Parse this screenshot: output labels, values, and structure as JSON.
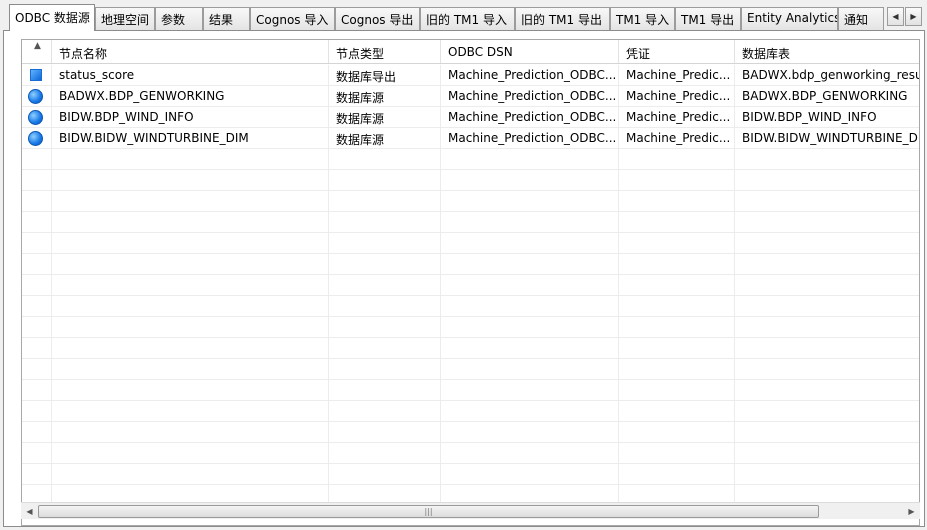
{
  "tabs": [
    {
      "label": "ODBC 数据源"
    },
    {
      "label": "地理空间"
    },
    {
      "label": "参数"
    },
    {
      "label": "结果"
    },
    {
      "label": "Cognos 导入"
    },
    {
      "label": "Cognos 导出"
    },
    {
      "label": "旧的 TM1 导入"
    },
    {
      "label": "旧的 TM1 导出"
    },
    {
      "label": "TM1 导入"
    },
    {
      "label": "TM1 导出"
    },
    {
      "label": "Entity Analytics"
    },
    {
      "label": "通知"
    }
  ],
  "tab_scroll": {
    "left_icon": "triangle-left-icon",
    "right_icon": "triangle-right-icon"
  },
  "table": {
    "sort_indicator": "sort-ascending-icon",
    "columns": [
      "节点名称",
      "节点类型",
      "ODBC DSN",
      "凭证",
      "数据库表"
    ],
    "rows": [
      {
        "icon": "export-node-icon",
        "name": "status_score",
        "type": "数据库导出",
        "dsn": "Machine_Prediction_ODBC...",
        "credential": "Machine_Predic...",
        "table": "BADWX.bdp_genworking_resul"
      },
      {
        "icon": "source-node-icon",
        "name": "BADWX.BDP_GENWORKING",
        "type": "数据库源",
        "dsn": "Machine_Prediction_ODBC...",
        "credential": "Machine_Predic...",
        "table": "BADWX.BDP_GENWORKING"
      },
      {
        "icon": "source-node-icon",
        "name": "BIDW.BDP_WIND_INFO",
        "type": "数据库源",
        "dsn": "Machine_Prediction_ODBC...",
        "credential": "Machine_Predic...",
        "table": "BIDW.BDP_WIND_INFO"
      },
      {
        "icon": "source-node-icon",
        "name": "BIDW.BIDW_WINDTURBINE_DIM",
        "type": "数据库源",
        "dsn": "Machine_Prediction_ODBC...",
        "credential": "Machine_Predic...",
        "table": "BIDW.BIDW_WINDTURBINE_DI"
      }
    ]
  },
  "hscroll": {
    "left_icon": "triangle-left-icon",
    "right_icon": "triangle-right-icon",
    "grip": "grip-icon"
  }
}
